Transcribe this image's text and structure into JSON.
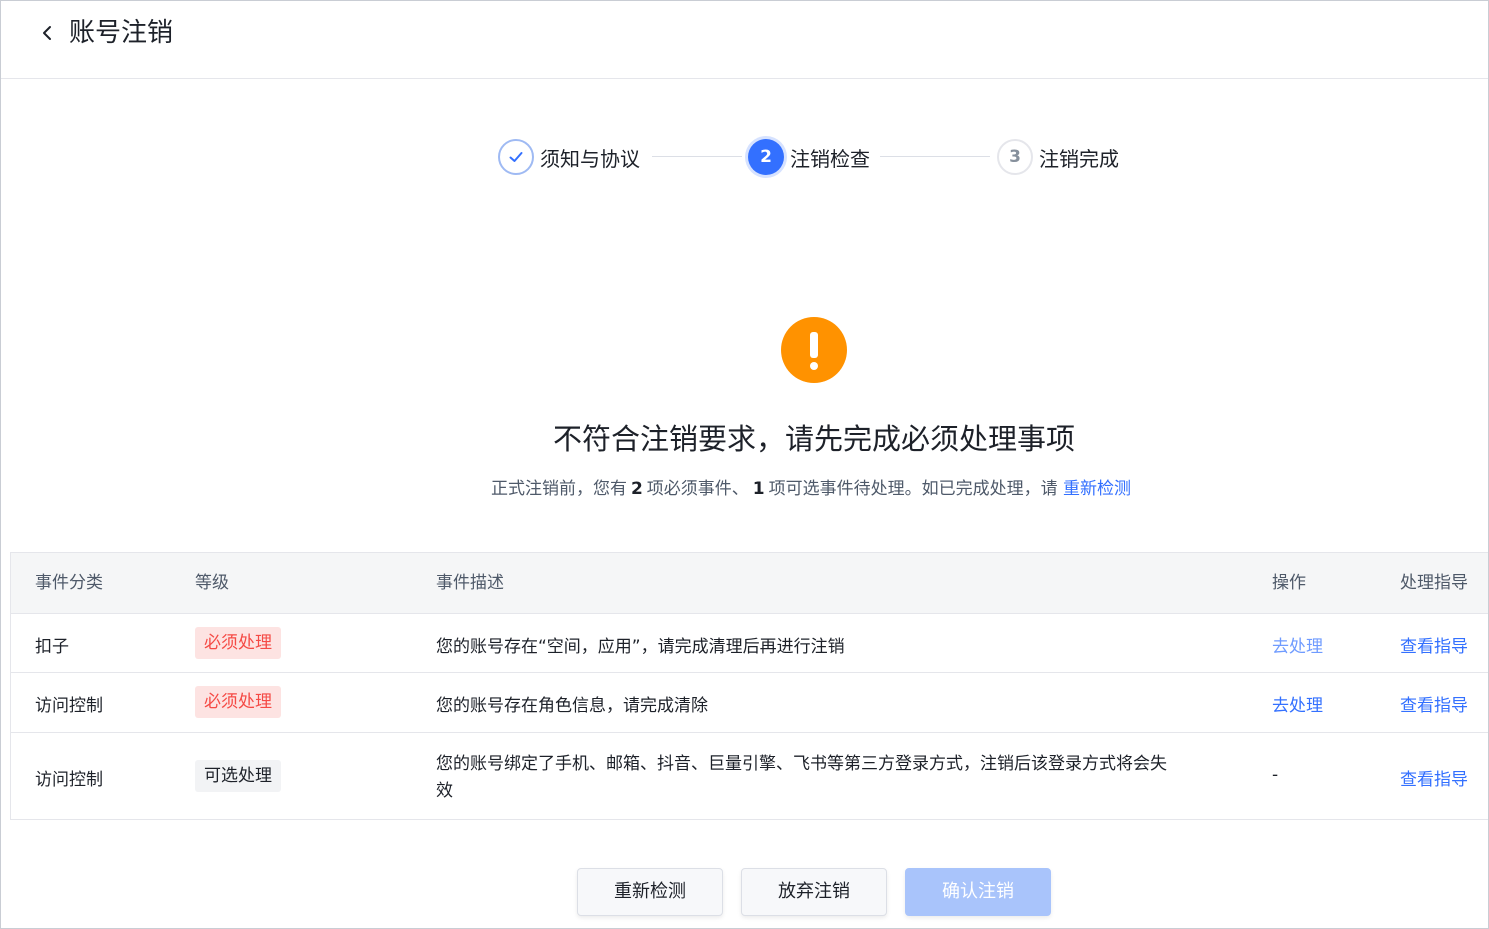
{
  "header": {
    "title": "账号注销"
  },
  "steps": [
    {
      "index": "",
      "label": "须知与协议",
      "status": "done"
    },
    {
      "index": "2",
      "label": "注销检查",
      "status": "active"
    },
    {
      "index": "3",
      "label": "注销完成",
      "status": "wait"
    }
  ],
  "result": {
    "title": "不符合注销要求，请先完成必须处理事项",
    "desc_prefix": "正式注销前，您有",
    "required_count": "2",
    "desc_mid": "项必须事件、",
    "optional_count": "1",
    "desc_suffix": "项可选事件待处理。如已完成处理，请",
    "recheck_link": "重新检测"
  },
  "table": {
    "headers": {
      "category": "事件分类",
      "level": "等级",
      "description": "事件描述",
      "action": "操作",
      "guide": "处理指导"
    },
    "rows": [
      {
        "category": "扣子",
        "level": "必须处理",
        "level_type": "required",
        "description": "您的账号存在“空间，应用”，请完成清理后再进行注销",
        "action": "去处理",
        "guide": "查看指导"
      },
      {
        "category": "访问控制",
        "level": "必须处理",
        "level_type": "required",
        "description": "您的账号存在角色信息，请完成清除",
        "action": "去处理",
        "guide": "查看指导"
      },
      {
        "category": "访问控制",
        "level": "可选处理",
        "level_type": "optional",
        "description_line1": "您的账号绑定了手机、邮箱、抖音、巨量引擎、飞书等第三方登录方式，注销后该登录方式将会失",
        "description_line2": "效",
        "action": "-",
        "guide": "查看指导"
      }
    ]
  },
  "footer": {
    "recheck": "重新检测",
    "abandon": "放弃注销",
    "confirm": "确认注销"
  },
  "colors": {
    "primary": "#3370ff",
    "warning": "#ff9200",
    "danger": "#f54a45",
    "primary_disabled": "#a9c4fb"
  }
}
